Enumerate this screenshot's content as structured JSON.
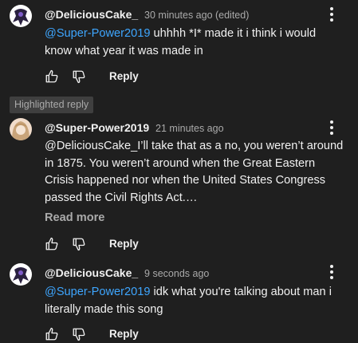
{
  "comments": [
    {
      "author": "@DeliciousCake_",
      "time": "30 minutes ago (edited)",
      "mention": "@Super-Power2019",
      "text_line1": " uhhhh *I* made it   i think i would",
      "text_line2": "know what year it was made in",
      "reply_label": "Reply"
    },
    {
      "badge": "Highlighted reply",
      "author": "@Super-Power2019",
      "time": "21 minutes ago",
      "lines": [
        "@DeliciousCake_I’ll take that as a no, you weren’t around",
        "in 1875. You weren’t around when the Great Eastern",
        "Crisis happened nor when the United States Congress",
        "passed the Civil Rights Act.…"
      ],
      "read_more": "Read more",
      "reply_label": "Reply"
    },
    {
      "author": "@DeliciousCake_",
      "time": "9 seconds ago",
      "mention": "@Super-Power2019",
      "text_line1": " idk what you're talking about man i",
      "text_line2": "literally made this song",
      "reply_label": "Reply"
    }
  ],
  "icons": {
    "like": "thumb-up-icon",
    "dislike": "thumb-down-icon",
    "more": "more-vert-icon"
  }
}
